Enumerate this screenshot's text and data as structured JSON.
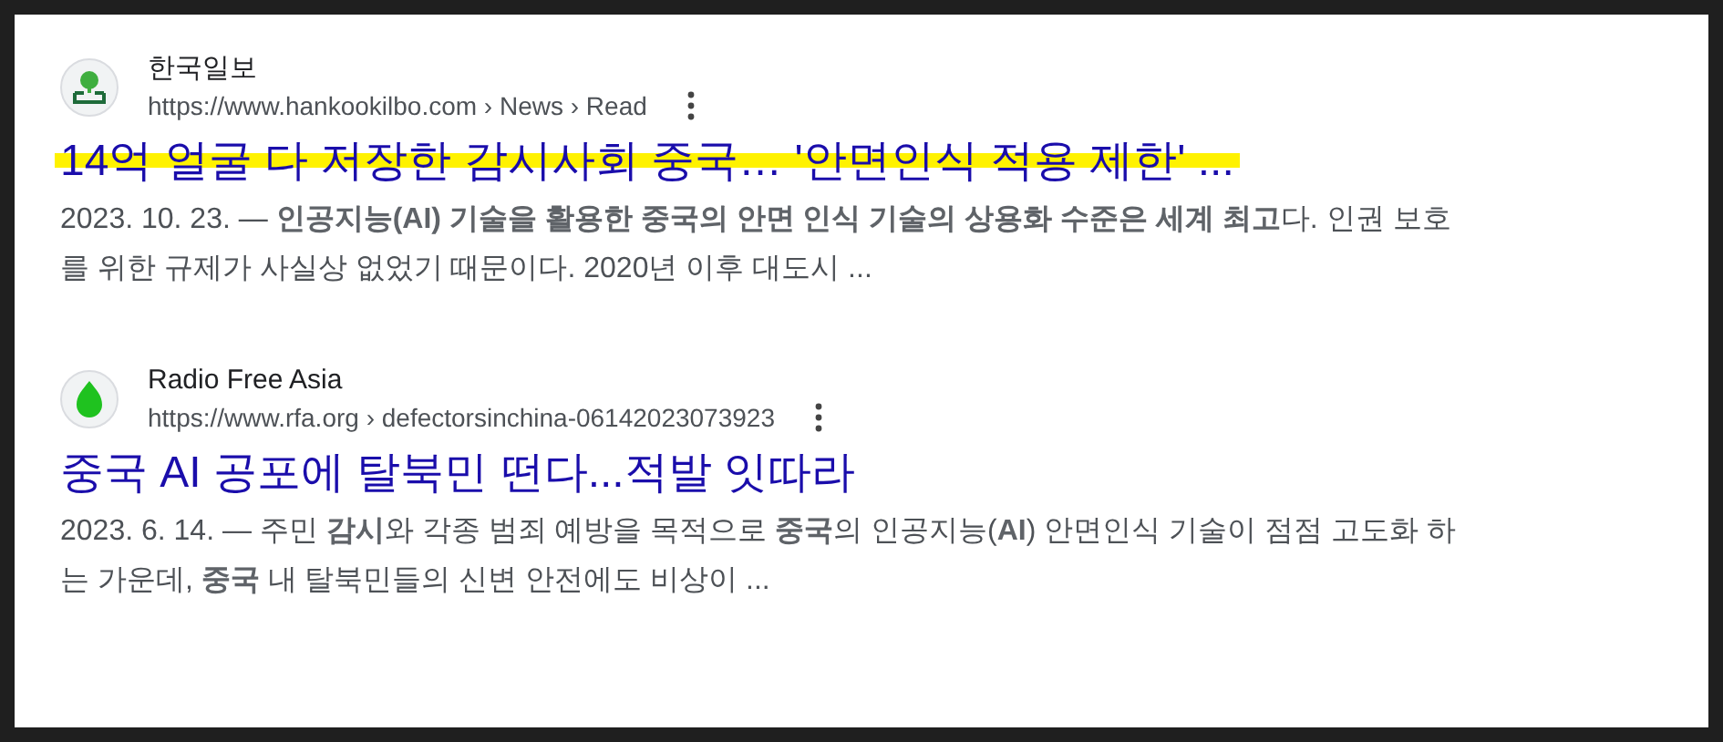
{
  "results": [
    {
      "site_name": "한국일보",
      "kind": "pin",
      "url": "https://www.hankookilbo.com › News › Read",
      "title": "14억 얼굴 다 저장한 감시사회 중국… '안면인식 적용 제한' ...",
      "highlighted": true,
      "snippet": "2023. 10. 23. — **인공지능(AI) 기술을 활용한 중국의 안면 인식 기술의 상용화 수준은 세계 최고**다. 인권 보호를 위한 규제가 사실상 없었기 때문이다. 2020년 이후 대도시 ..."
    },
    {
      "site_name": "Radio Free Asia",
      "kind": "drop",
      "url": "https://www.rfa.org › defectorsinchina-06142023073923",
      "title": "중국 AI 공포에 탈북민 떤다...적발 잇따라",
      "highlighted": false,
      "snippet": "2023. 6. 14. — 주민 **감시**와 각종 범죄 예방을 목적으로 **중국**의 인공지능(**AI**) 안면인식 기술이 점점 고도화 하는 가운데, **중국** 내 탈북민들의 신변 안전에도 비상이 ..."
    }
  ]
}
